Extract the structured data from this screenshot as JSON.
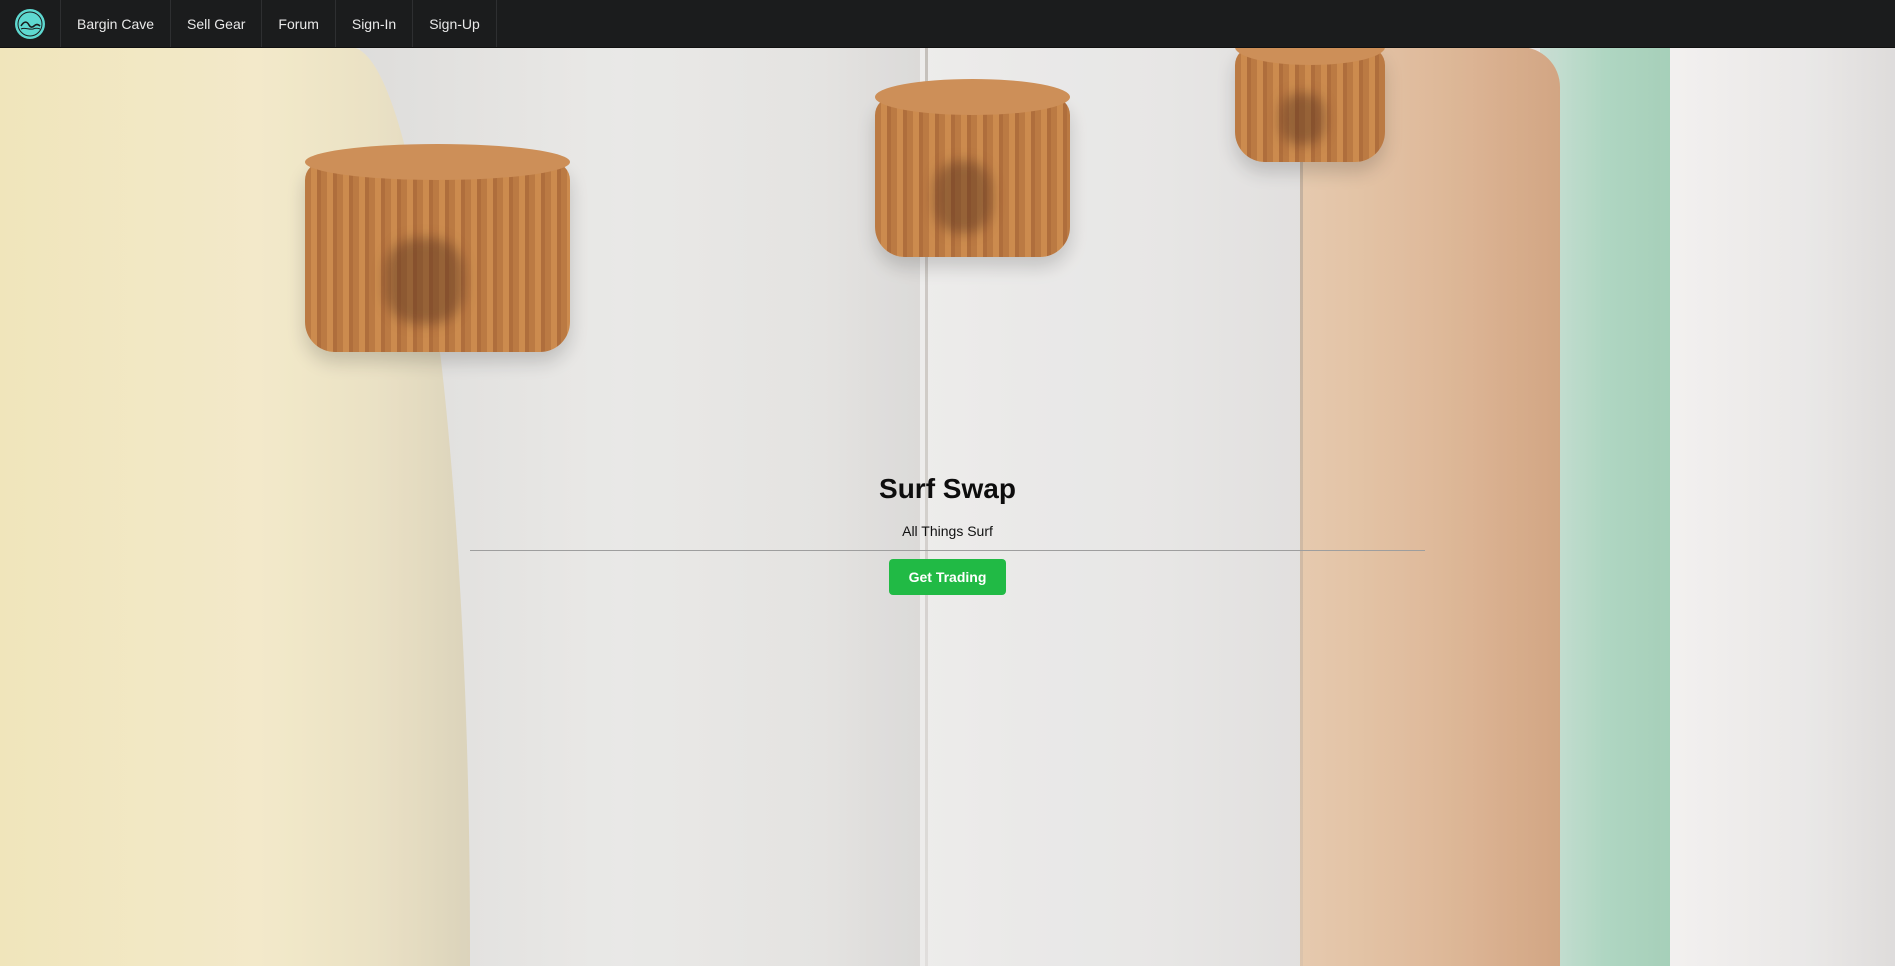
{
  "nav": {
    "logo_icon": "wave-logo-icon",
    "items": [
      {
        "label": "Bargin Cave"
      },
      {
        "label": "Sell Gear"
      },
      {
        "label": "Forum"
      },
      {
        "label": "Sign-In"
      },
      {
        "label": "Sign-Up"
      }
    ]
  },
  "hero": {
    "title": "Surf Swap",
    "subtitle": "All Things Surf",
    "cta_label": "Get Trading",
    "cta_color": "#21ba45"
  },
  "colors": {
    "navbar_bg": "#1b1c1d",
    "logo_bg": "#5ed8d0"
  }
}
